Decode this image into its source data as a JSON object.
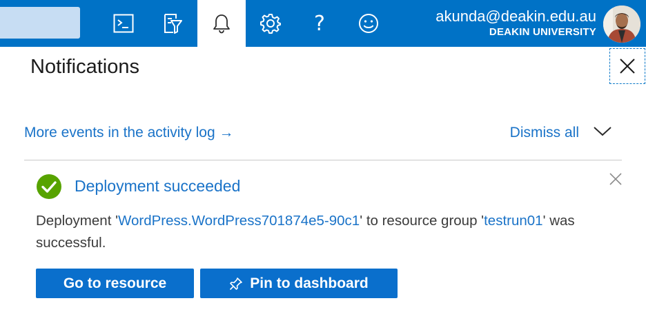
{
  "topbar": {
    "background": "#0072c6",
    "icons": [
      "cloud-shell-icon",
      "directory-filter-icon",
      "notifications-icon",
      "settings-icon",
      "help-icon",
      "feedback-icon"
    ],
    "help_glyph": "?",
    "account": {
      "email": "akunda@deakin.edu.au",
      "org": "DEAKIN UNIVERSITY"
    }
  },
  "panel": {
    "title": "Notifications",
    "activity_link": "More events in the activity log →",
    "dismiss_all": "Dismiss all"
  },
  "notification": {
    "status": "success",
    "status_color": "#57a300",
    "title": "Deployment succeeded",
    "body_prefix": "Deployment '",
    "deployment_name": "WordPress.WordPress701874e5-90c1",
    "body_middle": "' to resource group '",
    "resource_group": "testrun01",
    "body_suffix": "' was successful.",
    "buttons": {
      "go_to_resource": "Go to resource",
      "pin_to_dashboard": "Pin to dashboard"
    }
  },
  "colors": {
    "accent": "#0a6fcc",
    "link": "#1a73c8",
    "success": "#57a300"
  }
}
